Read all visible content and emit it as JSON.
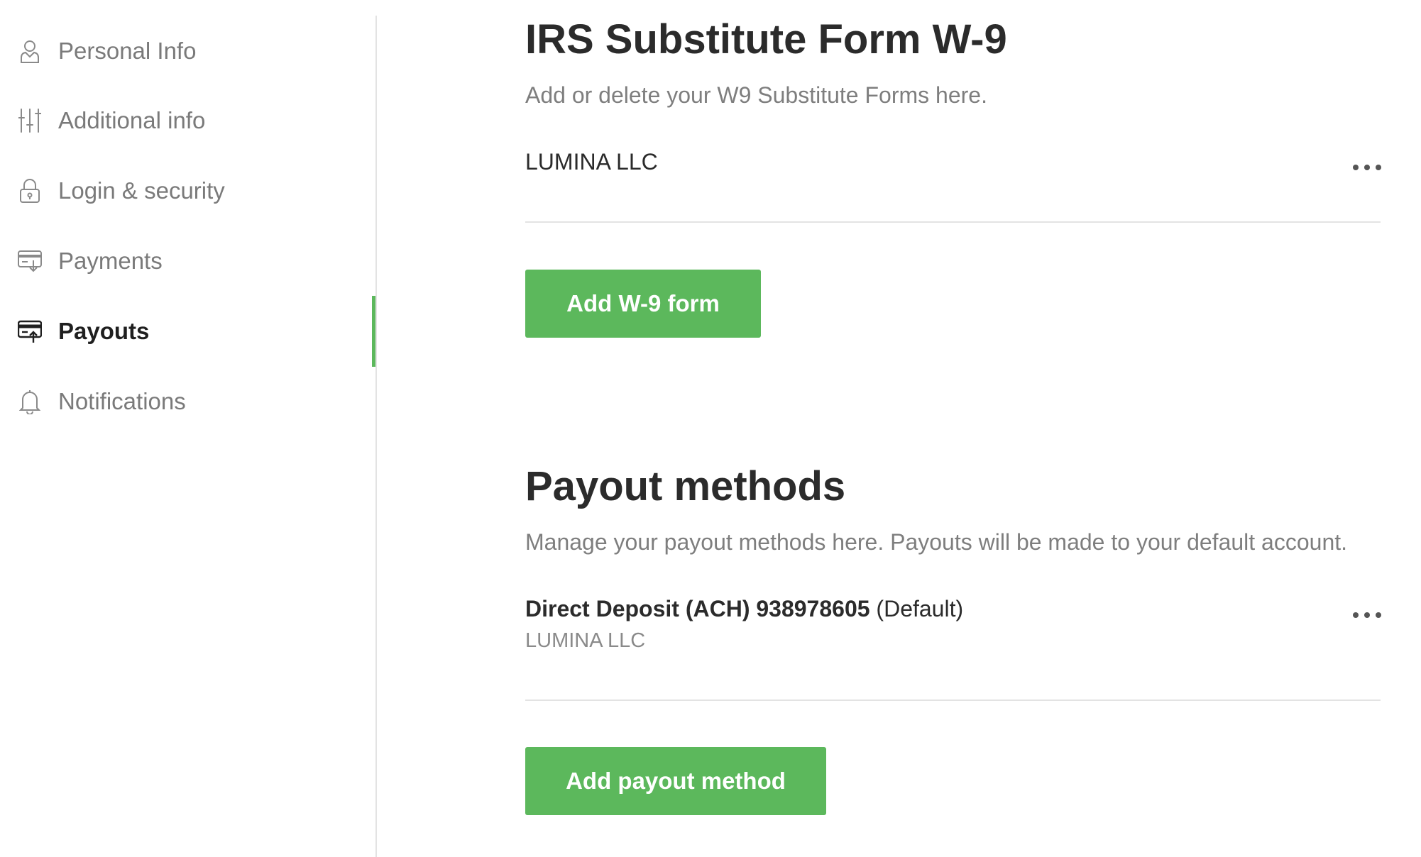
{
  "sidebar": {
    "items": [
      {
        "label": "Personal Info",
        "icon": "person-icon",
        "active": false
      },
      {
        "label": "Additional info",
        "icon": "sliders-icon",
        "active": false
      },
      {
        "label": "Login & security",
        "icon": "lock-icon",
        "active": false
      },
      {
        "label": "Payments",
        "icon": "credit-card-in-icon",
        "active": false
      },
      {
        "label": "Payouts",
        "icon": "credit-card-out-icon",
        "active": true
      },
      {
        "label": "Notifications",
        "icon": "bell-icon",
        "active": false
      }
    ]
  },
  "w9": {
    "title": "IRS Substitute Form W-9",
    "subtitle": "Add or delete your W9 Substitute Forms here.",
    "forms": [
      {
        "name": "LUMINA LLC"
      }
    ],
    "add_button_label": "Add W-9 form"
  },
  "payouts": {
    "title": "Payout methods",
    "subtitle": "Manage your payout methods here. Payouts will be made to your default account.",
    "methods": [
      {
        "name": "Direct Deposit (ACH) 938978605",
        "default_tag": "(Default)",
        "owner": "LUMINA LLC"
      }
    ],
    "add_button_label": "Add payout method"
  },
  "colors": {
    "accent": "#5cb85c",
    "active_text": "#1f1f1f",
    "muted_text": "#7a7a7a",
    "divider": "#e3e3e3"
  }
}
